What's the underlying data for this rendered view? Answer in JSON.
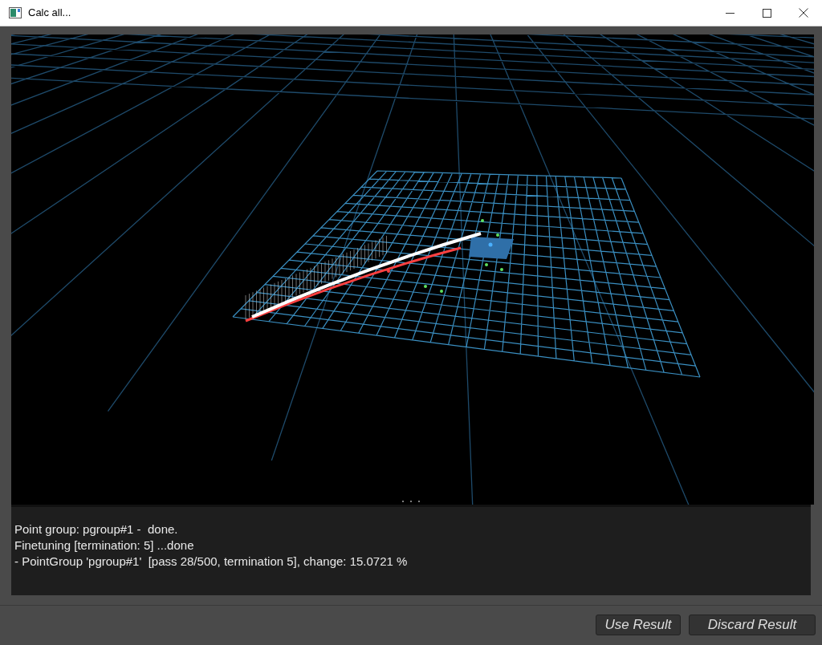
{
  "window": {
    "title": "Calc all..."
  },
  "log": {
    "lines": [
      "Point group: pgroup#1 -  done.",
      "Finetuning [termination: 5] ...done",
      "- PointGroup 'pgroup#1'  [pass 28/500, termination 5], change: 15.0721 %"
    ]
  },
  "buttons": [
    {
      "label": "Use Result"
    },
    {
      "label": "Discard Result"
    }
  ]
}
